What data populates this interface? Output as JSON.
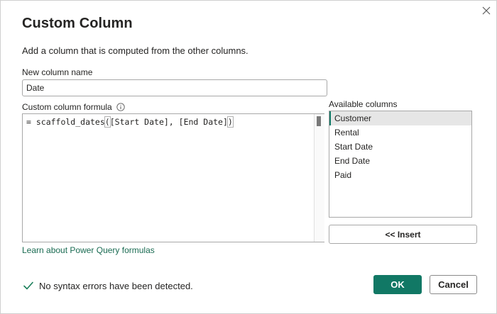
{
  "dialog": {
    "title": "Custom Column",
    "subtitle": "Add a column that is computed from the other columns.",
    "close_icon": "close-icon"
  },
  "column_name": {
    "label": "New column name",
    "value": "Date"
  },
  "formula": {
    "label": "Custom column formula",
    "info_icon": "info-icon",
    "prefix": "= scaffold_dates",
    "open_paren": "(",
    "args": "[Start Date], [End Date]",
    "close_paren": ")",
    "learn_link": "Learn about Power Query formulas"
  },
  "available_columns": {
    "label": "Available columns",
    "items": [
      "Customer",
      "Rental",
      "Start Date",
      "End Date",
      "Paid"
    ],
    "selected": "Customer",
    "insert_label": "<< Insert"
  },
  "status": {
    "icon": "check-icon",
    "message": "No syntax errors have been detected.",
    "color": "#1a7f5a"
  },
  "actions": {
    "ok_label": "OK",
    "cancel_label": "Cancel"
  },
  "colors": {
    "accent": "#117865",
    "link": "#1a6b52"
  }
}
